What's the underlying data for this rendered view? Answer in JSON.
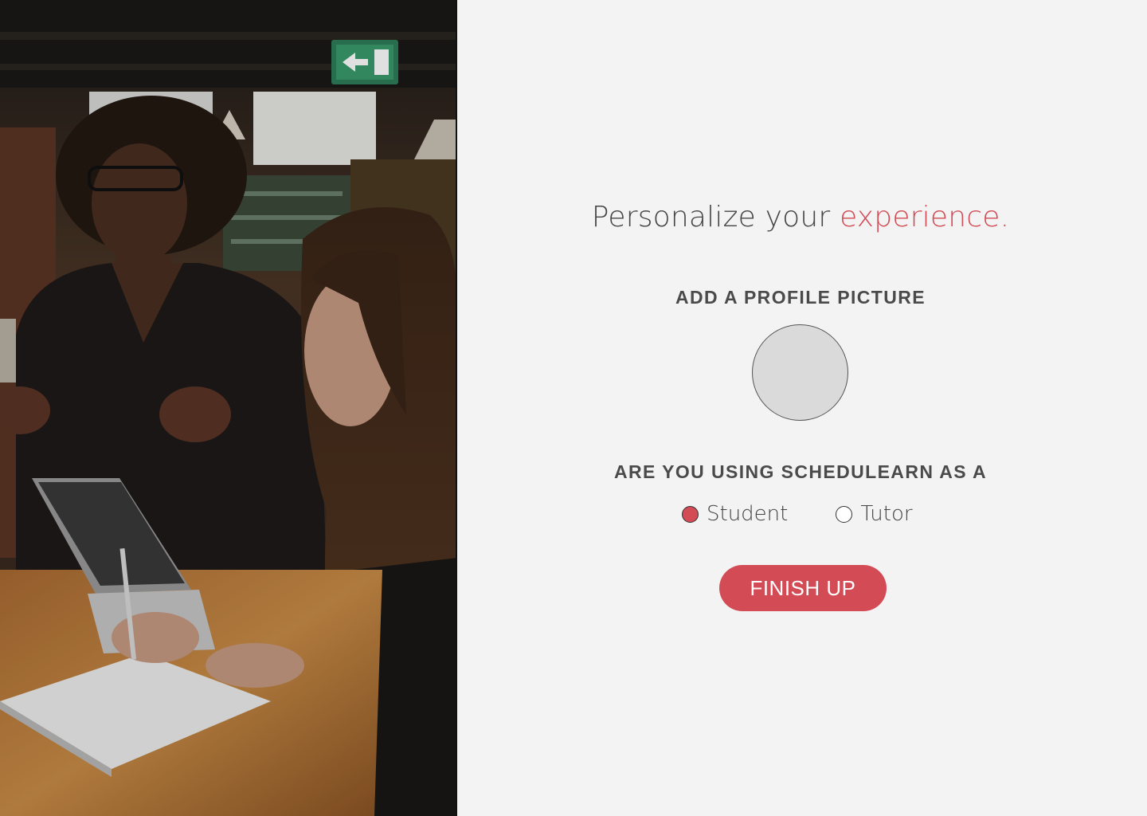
{
  "photo": {
    "description_icon": "photo-image"
  },
  "headline": {
    "main": "Personalize your ",
    "accent": "experience."
  },
  "profile": {
    "label": "ADD A PROFILE PICTURE"
  },
  "role": {
    "label": "ARE YOU USING SCHEDULEARN AS A",
    "options": [
      {
        "label": "Student",
        "selected": true
      },
      {
        "label": "Tutor",
        "selected": false
      }
    ]
  },
  "finish": {
    "label": "FINISH UP"
  },
  "colors": {
    "accent": "#d34b55",
    "background": "#f3f3f3",
    "text": "#454545"
  }
}
